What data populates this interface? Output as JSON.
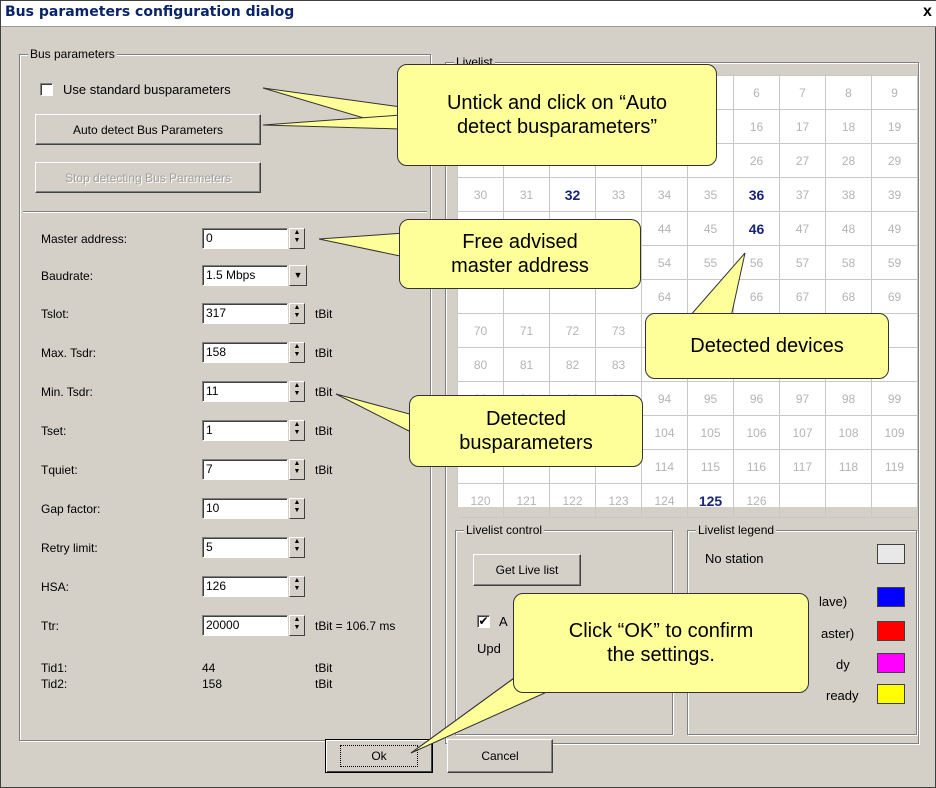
{
  "window": {
    "title": "Bus parameters configuration dialog",
    "close": "x"
  },
  "bus_group": {
    "label": "Bus parameters",
    "use_standard": "Use standard busparameters",
    "auto_detect": "Auto detect Bus Parameters",
    "stop_detect": "Stop detecting Bus Parameters"
  },
  "params": {
    "master_address": {
      "label": "Master address:",
      "value": "0"
    },
    "baudrate": {
      "label": "Baudrate:",
      "value": "1.5 Mbps"
    },
    "tslot": {
      "label": "Tslot:",
      "value": "317",
      "unit": "tBit"
    },
    "max_tsdr": {
      "label": "Max. Tsdr:",
      "value": "158",
      "unit": "tBit"
    },
    "min_tsdr": {
      "label": "Min. Tsdr:",
      "value": "11",
      "unit": "tBit"
    },
    "tset": {
      "label": "Tset:",
      "value": "1",
      "unit": "tBit"
    },
    "tquiet": {
      "label": "Tquiet:",
      "value": "7",
      "unit": "tBit"
    },
    "gap": {
      "label": "Gap factor:",
      "value": "10"
    },
    "retry": {
      "label": "Retry limit:",
      "value": "5"
    },
    "hsa": {
      "label": "HSA:",
      "value": "126"
    },
    "ttr": {
      "label": "Ttr:",
      "value": "20000",
      "unit": "tBit = 106.7 ms"
    },
    "tid1": {
      "label": "Tid1:",
      "value": "44",
      "unit": "tBit"
    },
    "tid2": {
      "label": "Tid2:",
      "value": "158",
      "unit": "tBit"
    }
  },
  "livelist": {
    "label": "Livelist",
    "detected": [
      32,
      36,
      46,
      125
    ],
    "cells": [
      [
        "6",
        "7",
        "8",
        "9"
      ],
      [
        "16",
        "17",
        "18",
        "19"
      ],
      [
        "26",
        "27",
        "28",
        "29"
      ],
      [
        "30",
        "31",
        "32",
        "33",
        "34",
        "35",
        "36",
        "37",
        "38",
        "39"
      ],
      [
        "44",
        "45",
        "46",
        "47",
        "48",
        "49"
      ],
      [
        "54",
        "55",
        "56",
        "57",
        "58",
        "59"
      ],
      [
        "64",
        "66",
        "67",
        "68",
        "69"
      ],
      [
        "70",
        "71",
        "72",
        "73"
      ],
      [
        "80",
        "81",
        "82",
        "83"
      ],
      [
        "90",
        "91",
        "92",
        "93",
        "94",
        "95",
        "96",
        "97",
        "98",
        "99"
      ],
      [
        "104",
        "105",
        "106",
        "107",
        "108",
        "109"
      ],
      [
        "114",
        "115",
        "116",
        "117",
        "118",
        "119"
      ],
      [
        "120",
        "121",
        "122",
        "123",
        "124",
        "125",
        "126"
      ]
    ]
  },
  "livelist_control": {
    "label": "Livelist control",
    "get_btn": "Get Live list",
    "auto_chk": "A",
    "update_lbl": "Upd"
  },
  "legend": {
    "label": "Livelist legend",
    "items": [
      {
        "text": "No station",
        "color": "#e8e8e8"
      },
      {
        "text": "lave)",
        "color": "#0000ff"
      },
      {
        "text": "aster)",
        "color": "#ff0000"
      },
      {
        "text": "dy",
        "color": "#ff00ff"
      },
      {
        "text": "ready",
        "color": "#ffff00"
      }
    ]
  },
  "footer": {
    "ok": "Ok",
    "cancel": "Cancel"
  },
  "callouts": {
    "auto": "Untick and click on “Auto\ndetect busparameters”",
    "master": "Free advised\nmaster address",
    "devices": "Detected devices",
    "detected": "Detected\nbusparameters",
    "ok": "Click “OK” to confirm\nthe settings."
  }
}
